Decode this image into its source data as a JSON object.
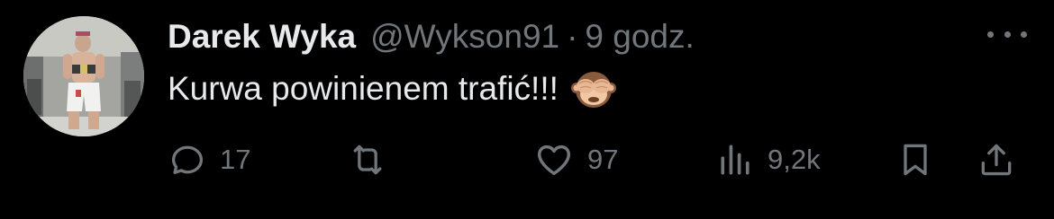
{
  "tweet": {
    "author": {
      "display_name": "Darek Wyka",
      "handle": "@Wykson91",
      "separator": "·",
      "time": "9 godz."
    },
    "text": "Kurwa powinienem trafić!!!",
    "emoji": "see-no-evil-monkey",
    "actions": {
      "replies": "17",
      "likes": "97",
      "views": "9,2k"
    }
  },
  "colors": {
    "background": "#000000",
    "primary_text": "#e7e9ea",
    "secondary_text": "#71767b"
  },
  "icons": [
    "more-icon",
    "reply-icon",
    "retweet-icon",
    "like-icon",
    "views-icon",
    "bookmark-icon",
    "share-icon"
  ]
}
